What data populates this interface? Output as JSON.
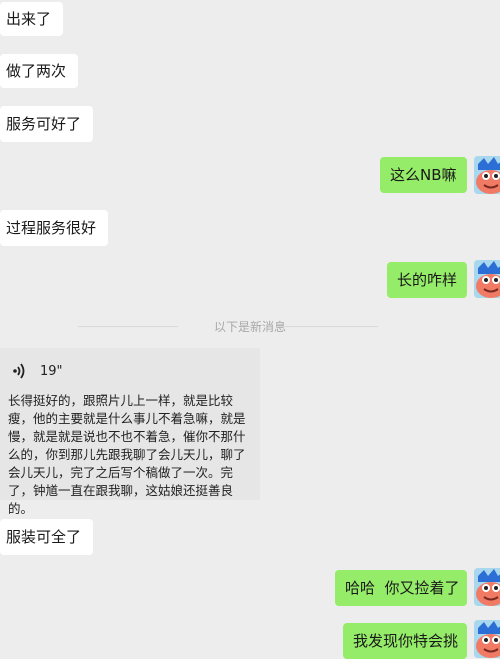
{
  "messages": {
    "m1": "出来了",
    "m2": "做了两次",
    "m3": "服务可好了",
    "m4": "这么NB嘛",
    "m5": "过程服务很好",
    "m6": "长的咋样",
    "m7": "服装可全了",
    "m8": "哈哈  你又捡着了",
    "m9": "我发现你特会挑"
  },
  "divider": "以下是新消息",
  "voice": {
    "duration": "19\"",
    "transcript": "长得挺好的，跟照片儿上一样，就是比较瘦，他的主要就是什么事儿不着急嘛，就是慢，就是就是说也不也不着急，催你不那什么的，你到那儿先跟我聊了会儿天儿，聊了会儿天儿，完了之后写个稿做了一次。完了，钟馗一直在跟我聊，这姑娘还挺善良的。"
  },
  "colors": {
    "background": "#ededed",
    "incoming_bubble": "#ffffff",
    "outgoing_bubble": "#95ec69"
  },
  "icons": {
    "avatar": "cartoon-avatar",
    "voice": "voice-wave-icon"
  }
}
